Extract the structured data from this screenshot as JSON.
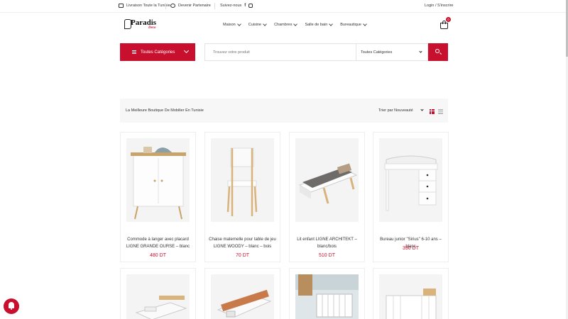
{
  "topbar": {
    "delivery": "Livraison Toute la Tunisie",
    "partners": "Devenir Partenaire",
    "follow": "Suivez-nous",
    "facebook_icon": "f",
    "login": "Login / S'inscrire"
  },
  "logo": {
    "brand": "Paradis",
    "sub": "Deco"
  },
  "nav": [
    "Maison",
    "Cuisine",
    "Chambres",
    "Salle de bain",
    "Bureautique"
  ],
  "cart": {
    "count": "0"
  },
  "categories_button": "Toutes Catégories",
  "search": {
    "placeholder": "Trouvez votre produit",
    "category": "Toutes Catégories"
  },
  "shop": {
    "title": "La Meilleure Boutique De Mobilier En Tunisie",
    "sort_prefix": "Trier par",
    "sort_value": "Nouveauté"
  },
  "products": [
    {
      "name": "Commode à langer avec placard LIGNE GRANDE OURSE – blanc",
      "price": "480 DT"
    },
    {
      "name": "Chaise maternelle pour table de jeu LIGNE WOODY – blanc – bois",
      "price": "70 DT"
    },
    {
      "name": "Lit enfant LIGNE ARCHITEKT – blanc/bois",
      "price": "510 DT"
    },
    {
      "name": "Bureau junior \"Sirius\" 6-10 ans – blanc",
      "price": "390 DT"
    }
  ],
  "colors": {
    "accent": "#c8102e",
    "toolbar_bg": "#f7f7f7"
  }
}
